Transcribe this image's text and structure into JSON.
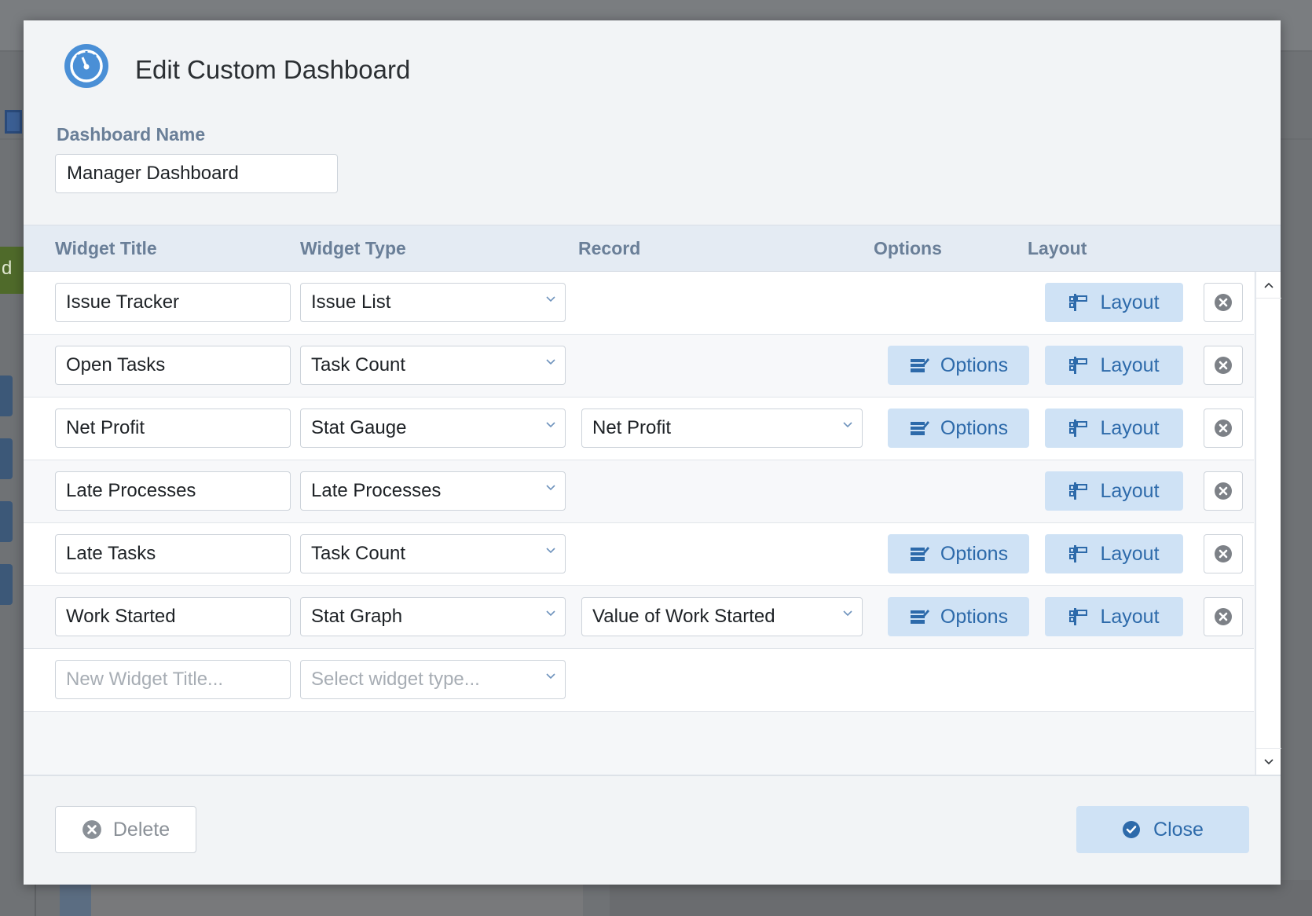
{
  "background": {
    "left_label": "d"
  },
  "modal": {
    "title": "Edit Custom Dashboard",
    "icon": "gauge-icon",
    "dashboard_name_label": "Dashboard Name",
    "dashboard_name_value": "Manager Dashboard"
  },
  "table": {
    "headers": {
      "widget_title": "Widget Title",
      "widget_type": "Widget Type",
      "record": "Record",
      "options": "Options",
      "layout": "Layout"
    },
    "rows": [
      {
        "title": "Issue Tracker",
        "type": "Issue List",
        "record": "",
        "has_options": false
      },
      {
        "title": "Open Tasks",
        "type": "Task Count",
        "record": "",
        "has_options": true
      },
      {
        "title": "Net Profit",
        "type": "Stat Gauge",
        "record": "Net Profit",
        "has_options": true
      },
      {
        "title": "Late Processes",
        "type": "Late Processes",
        "record": "",
        "has_options": false
      },
      {
        "title": "Late Tasks",
        "type": "Task Count",
        "record": "",
        "has_options": true
      },
      {
        "title": "Work Started",
        "type": "Stat Graph",
        "record": "Value of Work Started",
        "has_options": true
      }
    ],
    "options_label": "Options",
    "layout_label": "Layout",
    "new_row": {
      "title_placeholder": "New Widget Title...",
      "type_placeholder": "Select widget type..."
    }
  },
  "footer": {
    "delete_label": "Delete",
    "close_label": "Close"
  },
  "colors": {
    "accent": "#2d6aaa",
    "button_bg": "#cfe2f5",
    "header_label": "#6a7f98",
    "gauge": "#4a8fd6"
  }
}
